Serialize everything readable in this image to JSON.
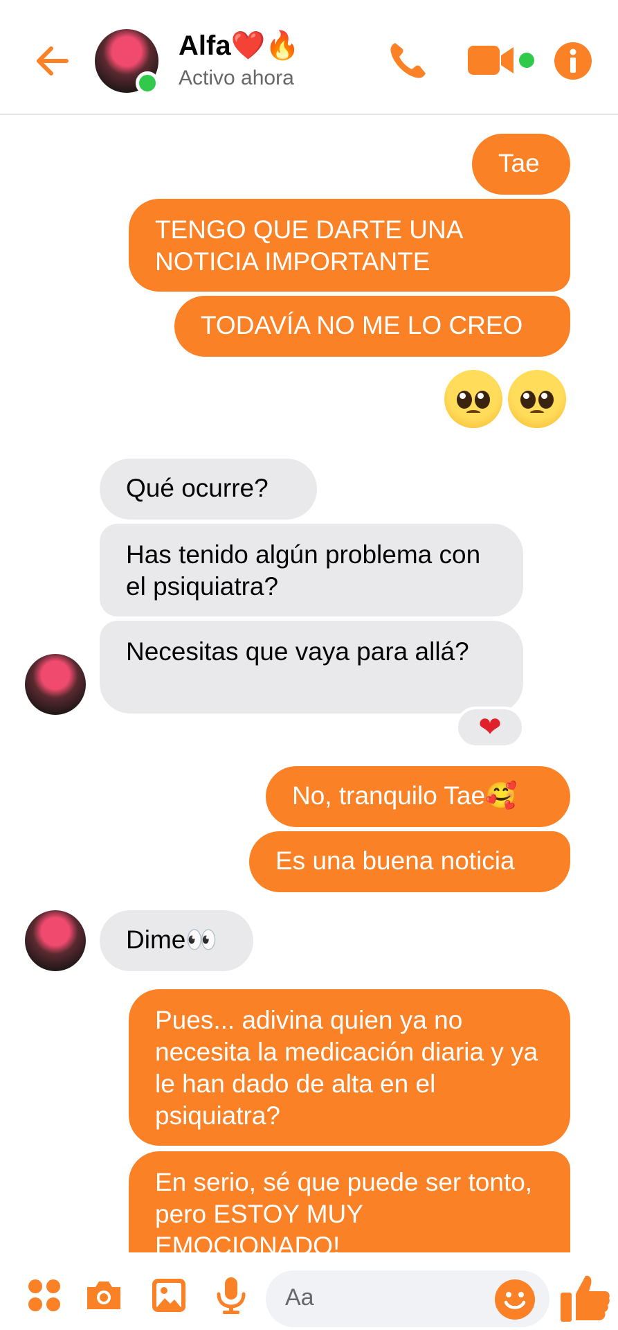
{
  "header": {
    "back_icon": "back-arrow-icon",
    "contact_name": "Alfa❤️🔥",
    "status": "Activo ahora",
    "icons": [
      "phone-icon",
      "video-camera-icon",
      "info-icon"
    ]
  },
  "messages": [
    {
      "dir": "out",
      "text": "Tae"
    },
    {
      "dir": "out",
      "text": "TENGO QUE DARTE UNA NOTICIA IMPORTANTE"
    },
    {
      "dir": "out",
      "text": "TODAVÍA NO ME LO CREO"
    },
    {
      "dir": "out",
      "text": "🥺🥺",
      "type": "emoji"
    },
    {
      "dir": "in",
      "text": "Qué ocurre?"
    },
    {
      "dir": "in",
      "text": "Has tenido algún problema con el psiquiatra?"
    },
    {
      "dir": "in",
      "text": "Necesitas que vaya para allá?",
      "reaction": "❤"
    },
    {
      "dir": "out",
      "text": "No, tranquilo Tae🥰"
    },
    {
      "dir": "out",
      "text": "Es una buena noticia"
    },
    {
      "dir": "in",
      "text": "Dime👀"
    },
    {
      "dir": "out",
      "text": "Pues... adivina quien ya no necesita la medicación diaria y ya le han dado de alta en el psiquiatra?"
    },
    {
      "dir": "out",
      "text": "En serio, sé que puede ser tonto, pero ESTOY MUY EMOCIONADO!"
    }
  ],
  "composer": {
    "placeholder": "Aa",
    "icons": [
      "apps-grid-icon",
      "camera-icon",
      "gallery-icon",
      "microphone-icon",
      "emoji-icon",
      "thumbs-up-icon"
    ]
  },
  "colors": {
    "accent": "#fa8125",
    "incoming_bubble": "#e9e9eb",
    "online": "#31c94a"
  }
}
